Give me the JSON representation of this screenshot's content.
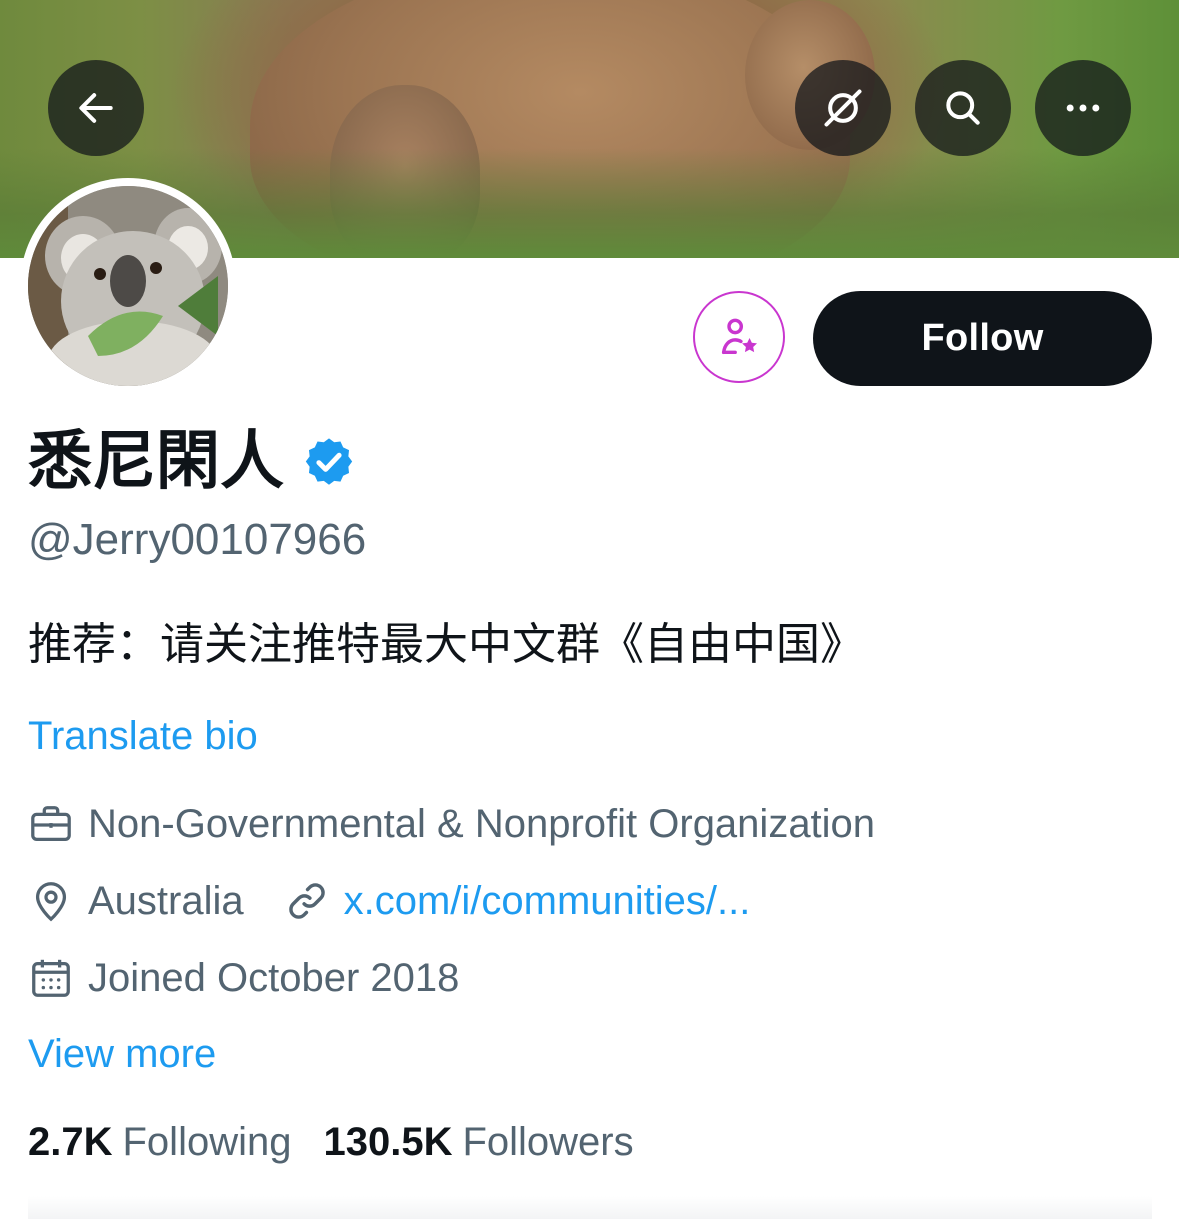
{
  "header": {
    "back_icon": "arrow-left-icon",
    "grok_icon": "grok-icon",
    "search_icon": "search-icon",
    "more_icon": "more-horizontal-icon"
  },
  "profile": {
    "display_name": "悉尼閑人",
    "verified": true,
    "handle": "@Jerry00107966",
    "bio": "推荐：请关注推特最大中文群《自由中国》",
    "translate_label": "Translate bio",
    "category": "Non-Governmental & Nonprofit Organization",
    "location": "Australia",
    "website": "x.com/i/communities/...",
    "joined": "Joined October 2018",
    "view_more_label": "View more"
  },
  "actions": {
    "follow_label": "Follow",
    "subscribe_icon": "subscribe-person-star-icon"
  },
  "stats": {
    "following_count": "2.7K",
    "following_label": "Following",
    "followers_count": "130.5K",
    "followers_label": "Followers"
  },
  "colors": {
    "accent": "#1d9bf0",
    "subscribe": "#c936cf",
    "text_primary": "#0f1419",
    "text_secondary": "#536471"
  }
}
